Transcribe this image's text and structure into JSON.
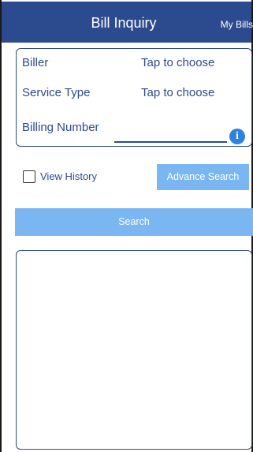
{
  "header": {
    "title": "Bill Inquiry",
    "my_bills_label": "My Bills"
  },
  "form": {
    "biller_label": "Biller",
    "biller_value": "Tap to choose",
    "service_type_label": "Service Type",
    "service_type_value": "Tap to choose",
    "billing_number_label": "Billing Number",
    "billing_number_value": "",
    "info_icon": "info-icon",
    "info_glyph": "i"
  },
  "options": {
    "view_history_label": "View History",
    "view_history_checked": false,
    "advance_search_label": "Advance Search"
  },
  "actions": {
    "search_label": "Search"
  },
  "colors": {
    "header_bg": "#2c4a8e",
    "button_bg": "#79b6f2",
    "accent_text": "#2c4a8e",
    "info_icon": "#2d82de"
  }
}
